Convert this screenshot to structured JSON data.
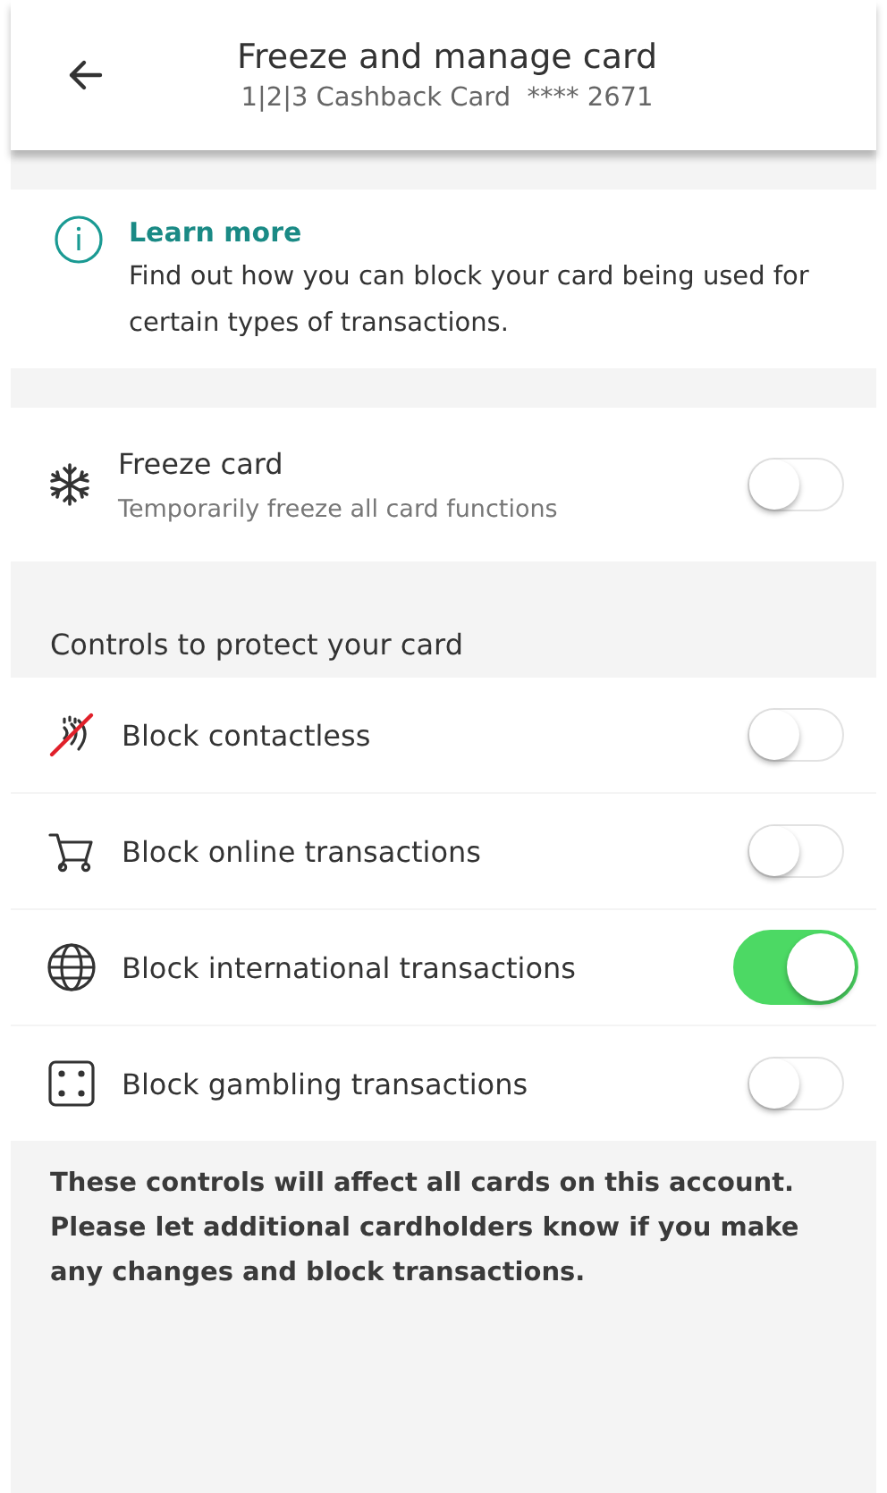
{
  "header": {
    "title": "Freeze and manage card",
    "subtitle": "1|2|3 Cashback Card  **** 2671"
  },
  "info": {
    "link": "Learn more",
    "text": "Find out how you can block your card being used for certain types of transactions."
  },
  "freeze": {
    "label": "Freeze card",
    "description": "Temporarily freeze all card functions",
    "on": false
  },
  "controls": {
    "heading": "Controls to protect your card",
    "items": [
      {
        "kind": "contactless",
        "label": "Block contactless",
        "on": false
      },
      {
        "kind": "cart",
        "label": "Block online transactions",
        "on": false
      },
      {
        "kind": "globe",
        "label": "Block international transactions",
        "on": true
      },
      {
        "kind": "dice",
        "label": "Block gambling transactions",
        "on": false
      }
    ]
  },
  "note": "These controls will affect all cards on this account. Please let additional cardholders know if you make any changes and block transactions."
}
